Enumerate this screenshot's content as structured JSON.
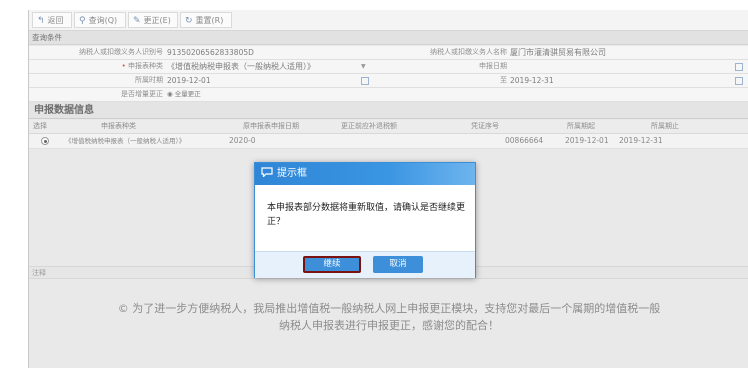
{
  "toolbar": {
    "back_label": "返回",
    "query_label": "查询(Q)",
    "correct_label": "更正(E)",
    "reset_label": "重置(R)"
  },
  "query_section": {
    "title": "查询条件",
    "taxpayer_id_label": "纳税人或扣缴义务人识别号",
    "taxpayer_id_value": "91350206562833805D",
    "taxpayer_name_label": "纳税人或扣缴义务人名称",
    "taxpayer_name_value": "厦门市灌清骐贸易有限公司",
    "report_type_label": "申报表种类",
    "report_type_value": "《增值税纳税申报表（一般纳税人适用）》",
    "report_date_label": "申报日期",
    "period_label": "所属时期",
    "period_start": "2019-12-01",
    "period_to": "至",
    "period_end": "2019-12-31",
    "vat_label": "是否增量更正",
    "vat_option": "全量更正"
  },
  "declaration": {
    "title": "申报数据信息",
    "columns": [
      "选择",
      "申报表种类",
      "原申报表申报日期",
      "更正前应补退税额",
      "凭证序号",
      "所属期起",
      "所属期止"
    ],
    "rows": [
      {
        "type": "《增值税纳税申报表（一般纳税人适用）》",
        "date": "2020-0",
        "voucher": "00866664",
        "start": "2019-12-01",
        "end": "2019-12-31"
      }
    ]
  },
  "note": {
    "title": "注释",
    "line1": "© 为了进一步方便纳税人，我局推出增值税一般纳税人网上申报更正模块，支持您对最后一个属期的增值税一般",
    "line2": "纳税人申报表进行申报更正，感谢您的配合！"
  },
  "dialog": {
    "title": "提示框",
    "message": "本申报表部分数据将重新取值，请确认是否继续更正？",
    "confirm_label": "继续",
    "cancel_label": "取消"
  }
}
